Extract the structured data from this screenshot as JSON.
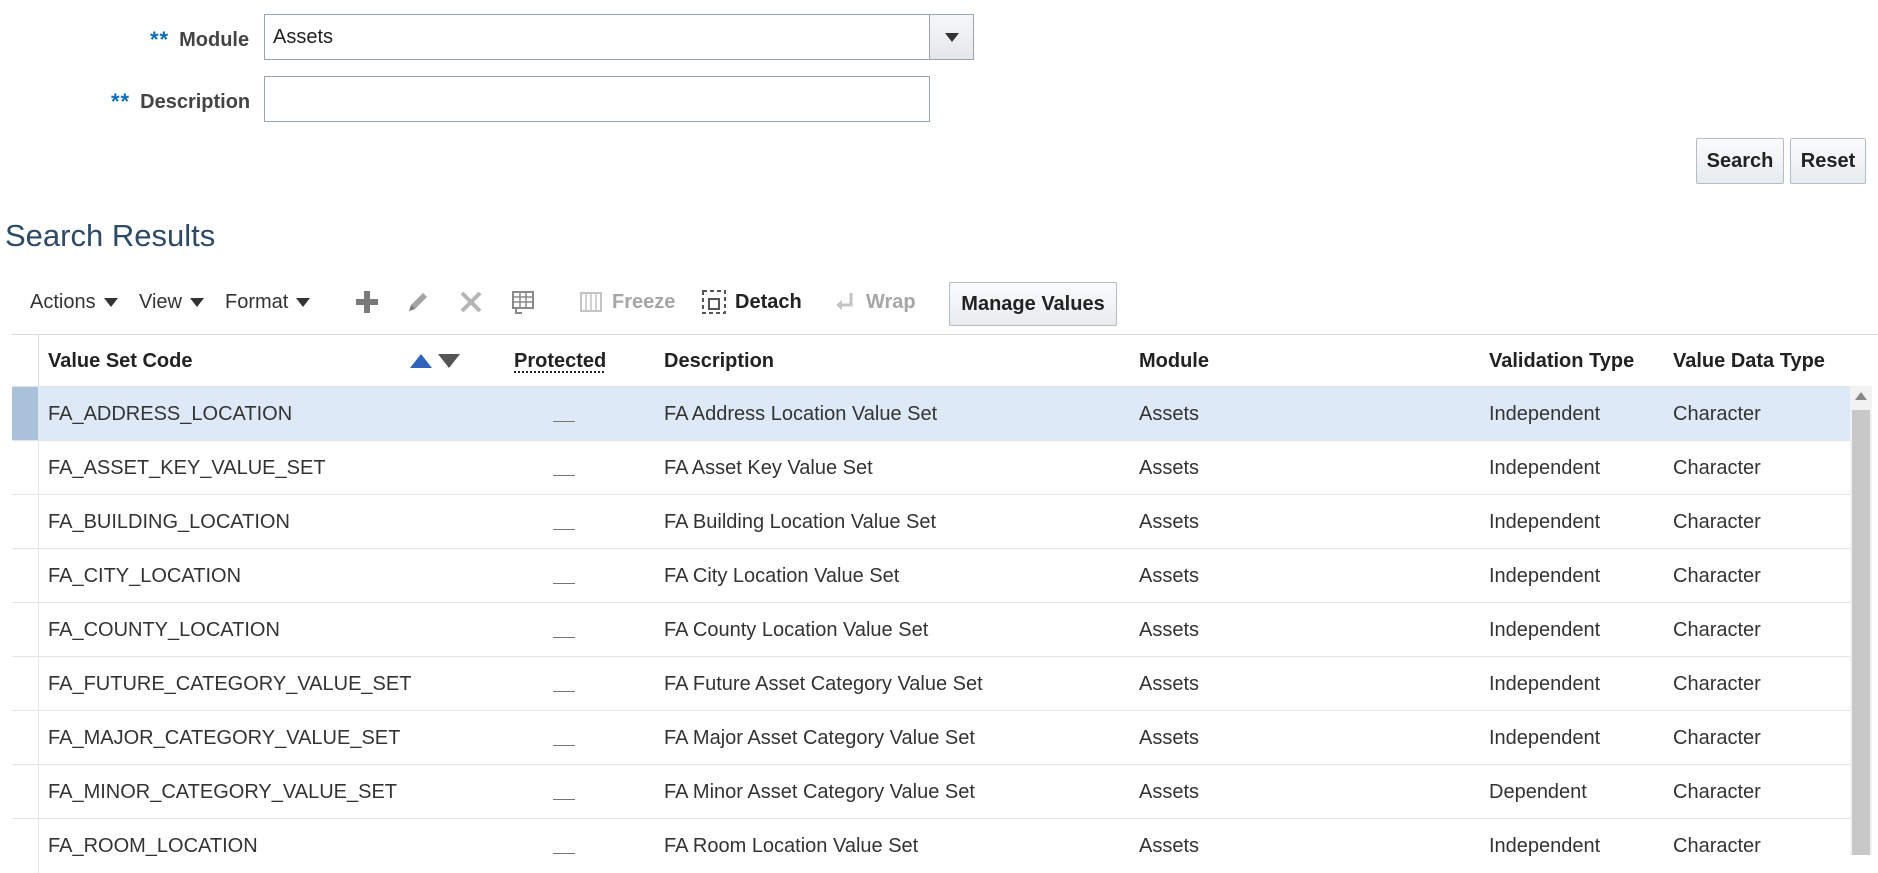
{
  "form": {
    "required_marker": "**",
    "module_label": "Module",
    "module_value": "Assets",
    "description_label": "Description",
    "description_value": "",
    "search_button": "Search",
    "reset_button": "Reset"
  },
  "results": {
    "title": "Search Results",
    "toolbar": {
      "actions": "Actions",
      "view": "View",
      "format": "Format",
      "add_icon": "plus-icon",
      "edit_icon": "pencil-icon",
      "delete_icon": "x-icon",
      "export_icon": "table-export-icon",
      "freeze": "Freeze",
      "detach": "Detach",
      "wrap": "Wrap",
      "manage_values": "Manage Values"
    },
    "columns": {
      "code": "Value Set Code",
      "protected": "Protected",
      "description": "Description",
      "module": "Module",
      "validation": "Validation Type",
      "datatype": "Value Data Type"
    },
    "rows": [
      {
        "code": "FA_ADDRESS_LOCATION",
        "description": "FA Address Location Value Set",
        "module": "Assets",
        "validation": "Independent",
        "datatype": "Character",
        "selected": true
      },
      {
        "code": "FA_ASSET_KEY_VALUE_SET",
        "description": "FA Asset Key Value Set",
        "module": "Assets",
        "validation": "Independent",
        "datatype": "Character"
      },
      {
        "code": "FA_BUILDING_LOCATION",
        "description": "FA Building Location Value Set",
        "module": "Assets",
        "validation": "Independent",
        "datatype": "Character"
      },
      {
        "code": "FA_CITY_LOCATION",
        "description": "FA City Location Value Set",
        "module": "Assets",
        "validation": "Independent",
        "datatype": "Character"
      },
      {
        "code": "FA_COUNTY_LOCATION",
        "description": "FA County Location Value Set",
        "module": "Assets",
        "validation": "Independent",
        "datatype": "Character"
      },
      {
        "code": "FA_FUTURE_CATEGORY_VALUE_SET",
        "description": "FA Future Asset Category Value Set",
        "module": "Assets",
        "validation": "Independent",
        "datatype": "Character"
      },
      {
        "code": "FA_MAJOR_CATEGORY_VALUE_SET",
        "description": "FA Major Asset Category Value Set",
        "module": "Assets",
        "validation": "Independent",
        "datatype": "Character"
      },
      {
        "code": "FA_MINOR_CATEGORY_VALUE_SET",
        "description": "FA Minor Asset Category Value Set",
        "module": "Assets",
        "validation": "Dependent",
        "datatype": "Character"
      },
      {
        "code": "FA_ROOM_LOCATION",
        "description": "FA Room Location Value Set",
        "module": "Assets",
        "validation": "Independent",
        "datatype": "Character"
      }
    ]
  },
  "colors": {
    "required": "#0d6db8",
    "title": "#2d4b66",
    "selected_row": "#dde9f7"
  }
}
